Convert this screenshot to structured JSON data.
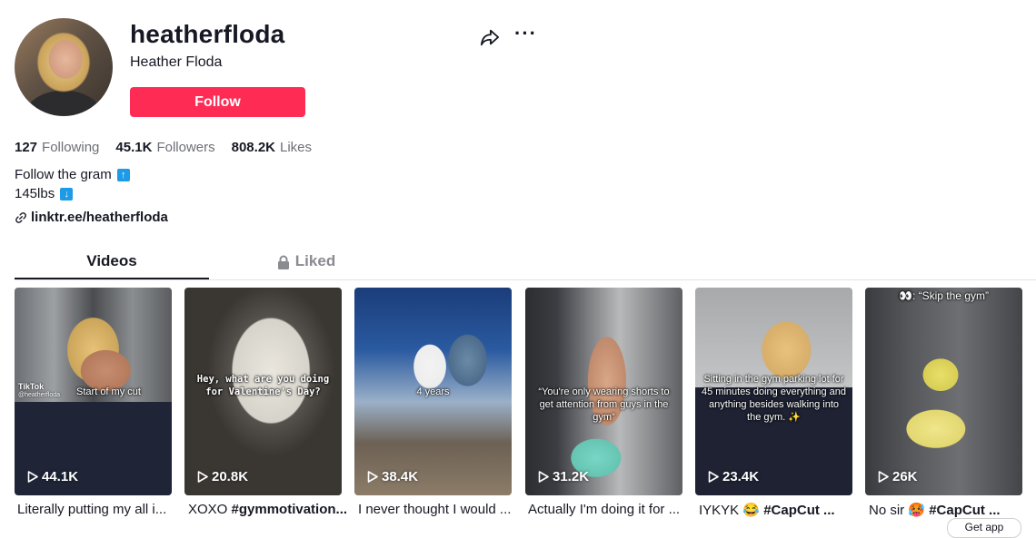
{
  "profile": {
    "username": "heatherfloda",
    "nickname": "Heather Floda",
    "follow_label": "Follow"
  },
  "stats": [
    {
      "value": "127",
      "label": "Following"
    },
    {
      "value": "45.1K",
      "label": "Followers"
    },
    {
      "value": "808.2K",
      "label": "Likes"
    }
  ],
  "bio": {
    "line1": "Follow the gram",
    "line1_icon": "up-arrow-emoji",
    "line2": "145lbs",
    "line2_icon": "down-arrow-emoji",
    "link": "linktr.ee/heatherfloda"
  },
  "tabs": {
    "videos": "Videos",
    "liked": "Liked"
  },
  "videos": [
    {
      "overlay": "Start of my cut",
      "watermark": "TikTok",
      "watermark_handle": "@heatherfloda",
      "views": "44.1K",
      "caption": "Literally putting my all i..."
    },
    {
      "overlay": "Hey, what are you doing for Valentine's Day?",
      "views": "20.8K",
      "caption_prefix": "XOXO ",
      "caption_tag": "#gymmotivation..."
    },
    {
      "overlay": "4 years",
      "views": "38.4K",
      "caption": "I never thought I would ..."
    },
    {
      "overlay": "“You're only wearing shorts to get attention from guys in the gym”",
      "views": "31.2K",
      "caption": "Actually I'm doing it for ..."
    },
    {
      "overlay": "Sitting in the gym parking lot for 45 minutes doing everything and anything besides walking into the gym. ✨",
      "views": "23.4K",
      "caption_prefix": "IYKYK 😂 ",
      "caption_tag": "#CapCut ..."
    },
    {
      "overlay": "👀: “Skip the gym”",
      "views": "26K",
      "caption_prefix": "No sir 🥵 ",
      "caption_tag": "#CapCut ..."
    }
  ],
  "get_app": "Get app",
  "colors": {
    "accent": "#fe2c55",
    "text": "#161823",
    "muted": "#6d6f77",
    "emoji_blue": "#1e9ae6"
  }
}
